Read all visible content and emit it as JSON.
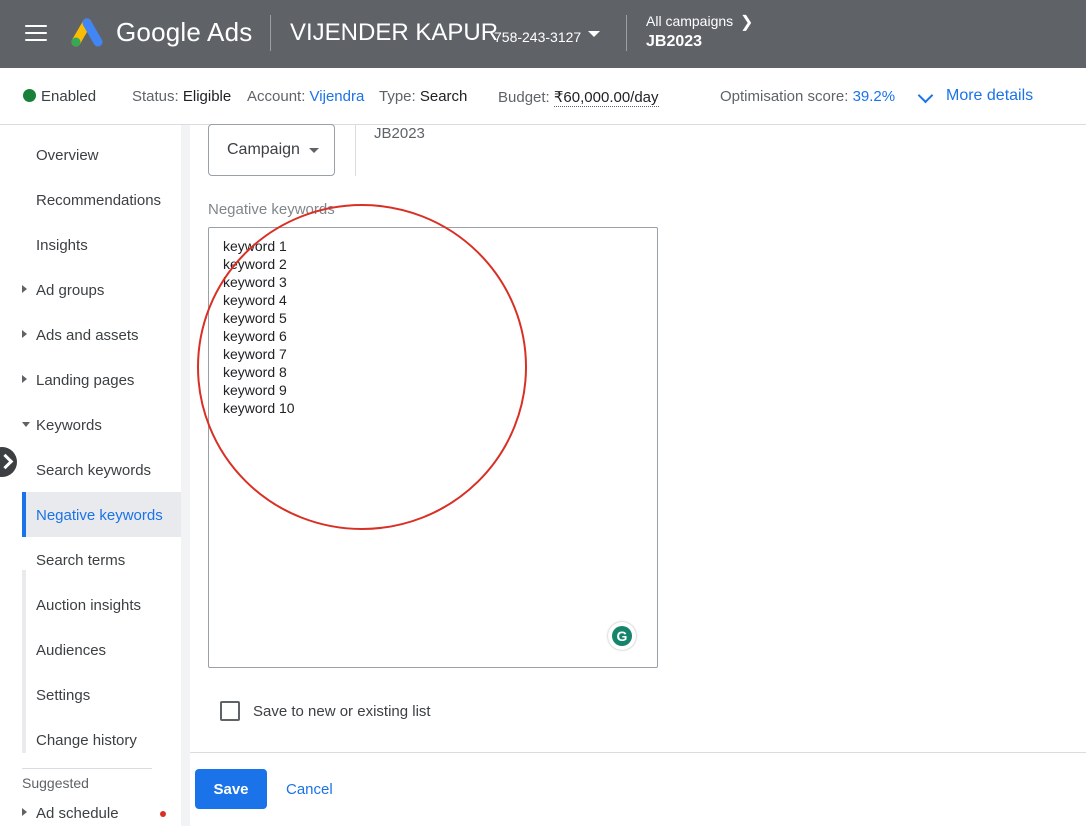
{
  "header": {
    "brand": "Google Ads",
    "account_name": "VIJENDER KAPUR",
    "account_id": "758-243-3127",
    "breadcrumb_parent": "All campaigns",
    "breadcrumb_current": "JB2023"
  },
  "status_bar": {
    "state": "Enabled",
    "status_label": "Status:",
    "status_value": "Eligible",
    "account_label": "Account:",
    "account_value": "Vijendra",
    "type_label": "Type:",
    "type_value": "Search",
    "budget_label": "Budget:",
    "budget_value": "₹60,000.00/day",
    "optimisation_label": "Optimisation score:",
    "optimisation_value": "39.2%",
    "more_details": "More details"
  },
  "sidebar": {
    "overview": "Overview",
    "recommendations": "Recommendations",
    "insights": "Insights",
    "ad_groups": "Ad groups",
    "ads_assets": "Ads and assets",
    "landing_pages": "Landing pages",
    "keywords": "Keywords",
    "search_keywords": "Search keywords",
    "negative_keywords": "Negative keywords",
    "search_terms": "Search terms",
    "auction_insights": "Auction insights",
    "audiences": "Audiences",
    "settings": "Settings",
    "change_history": "Change history",
    "suggested": "Suggested",
    "ad_schedule": "Ad schedule"
  },
  "form": {
    "level_select": "Campaign",
    "campaign_name": "JB2023",
    "negative_keywords_label": "Negative keywords",
    "keywords": [
      "keyword 1",
      "keyword 2",
      "keyword 3",
      "keyword 4",
      "keyword 5",
      "keyword 6",
      "keyword 7",
      "keyword 8",
      "keyword 9",
      "keyword 10"
    ],
    "save_to_list_label": "Save to new or existing list",
    "save_to_list_checked": false,
    "save_label": "Save",
    "cancel_label": "Cancel"
  },
  "colors": {
    "topbar": "#5f6368",
    "accent": "#1a73e8",
    "enabled_dot": "#188038",
    "annotation": "#d93025"
  }
}
